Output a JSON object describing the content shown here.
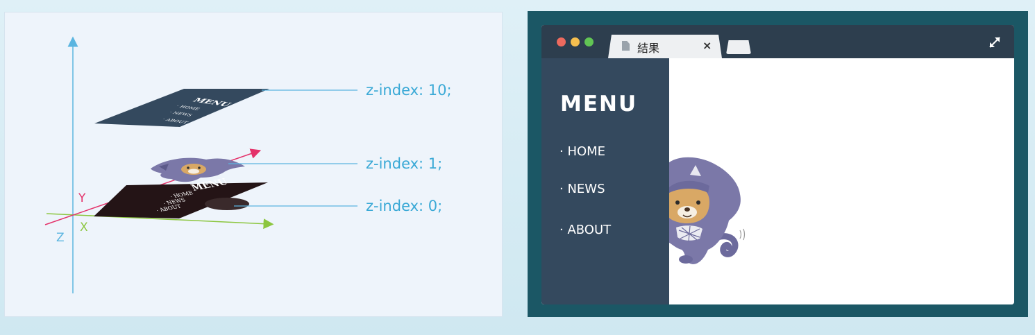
{
  "diagram": {
    "axes": {
      "x": "X",
      "y": "Y",
      "z": "Z"
    },
    "layers": [
      {
        "z_index_label": "z-index: 10;",
        "content": {
          "title": "MENU",
          "items": [
            "· HOME",
            "· NEWS",
            "· ABOUT"
          ]
        },
        "color": "#34495e"
      },
      {
        "z_index_label": "z-index: 1;",
        "content": "mascot-character",
        "color": "#7b78a8"
      },
      {
        "z_index_label": "z-index: 0;",
        "content": {
          "title": "MENU",
          "items": [
            "· HOME",
            "· NEWS",
            "· ABOUT"
          ]
        },
        "color": "#241416"
      }
    ],
    "colors": {
      "x_axis": "#8cc63f",
      "y_axis": "#e4326a",
      "z_axis": "#5bb5e0",
      "leader": "#5bb5e0",
      "label": "#3aa9d6"
    }
  },
  "browser": {
    "window_buttons": [
      "close",
      "minimize",
      "zoom"
    ],
    "window_button_colors": [
      "#ed6a5e",
      "#f5bf4f",
      "#61c554"
    ],
    "tab": {
      "title": "結果",
      "close_symbol": "×",
      "icon": "document-icon"
    },
    "expand_icon": "expand-arrows-icon",
    "sidebar": {
      "title": "MENU",
      "items": [
        "· HOME",
        "· NEWS",
        "· ABOUT"
      ]
    },
    "mascot": "ninja-cat-mascot",
    "colors": {
      "frame": "#1b5765",
      "titlebar": "#2d3e4e",
      "sidebar": "#34495e",
      "content": "#ffffff"
    }
  }
}
